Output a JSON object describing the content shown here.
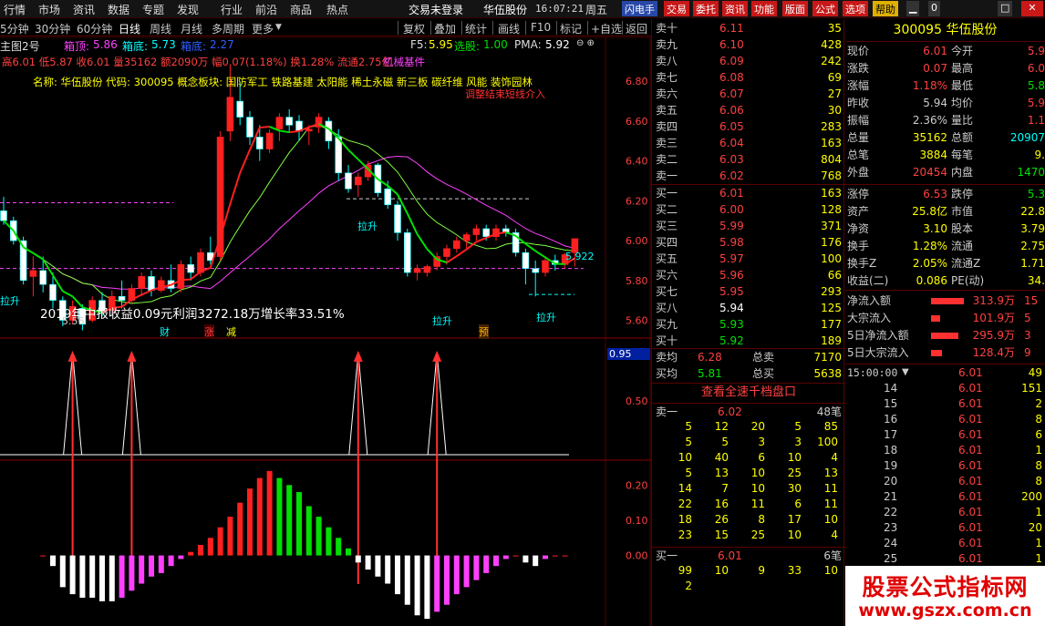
{
  "menu": {
    "items": [
      "行情",
      "市场",
      "资讯",
      "数据",
      "专题",
      "发现",
      "行业",
      "前沿",
      "商品",
      "热点"
    ],
    "trade_status": "交易未登录",
    "stock_name": "华伍股份",
    "time": "16:07:21",
    "weekday": "周五",
    "buttons": [
      "闪电手",
      "交易",
      "委托",
      "资讯",
      "功能",
      "版面",
      "公式",
      "选项",
      "帮助"
    ],
    "badge": "0"
  },
  "toolbar": {
    "periods": [
      "5分钟",
      "30分钟",
      "60分钟",
      "日线",
      "周线",
      "月线",
      "多周期",
      "更多"
    ],
    "actions": [
      "复权",
      "叠加",
      "统计",
      "画线",
      "F10",
      "标记",
      "+自选",
      "返回"
    ]
  },
  "chart_info": {
    "indicator_name": "主图2号",
    "box_top_label": "箱顶:",
    "box_top_value": "5.86",
    "box_bottom_label": "箱底:",
    "box_bottom_value": "5.73",
    "box_third_label": "箱底:",
    "box_third_value": "2.27",
    "f5_label": "F5:",
    "f5_value": "5.95",
    "pick_label": "选股:",
    "pick_value": "1.00",
    "pma_label": "PMA:",
    "pma_value": "5.92",
    "ohlc_line": "高6.01 低5.87 收6.01 量35162 额2090万 幅0.07(1.18%) 换1.28% 流通2.75亿",
    "industry": "机械基件",
    "concept_line": "名称: 华伍股份 代码: 300095 概念板块: 国防军工 铁路基建 太阳能 稀土永磁 新三板 碳纤维 风能 装饰园林",
    "annotation_right": "调整结束短线介入",
    "earnings": "2019年中报收益0.09元利润3272.18万增长率33.51%",
    "low_label": "5.56",
    "last_label": "5.922",
    "ascend_labels": [
      "拉升",
      "拉升",
      "拉升",
      "拉升"
    ],
    "event_labels": [
      "财",
      "涨",
      "减",
      "预"
    ],
    "osc_value": "0.95"
  },
  "chart_data": [
    {
      "type": "candlestick",
      "title": "",
      "yticks": [
        "6.80",
        "6.60",
        "6.40",
        "6.20",
        "6.00",
        "5.80",
        "5.60"
      ],
      "ylim": [
        5.52,
        6.92
      ],
      "candles": [
        {
          "o": 6.15,
          "h": 6.22,
          "l": 6.08,
          "c": 6.1
        },
        {
          "o": 6.1,
          "h": 6.12,
          "l": 5.98,
          "c": 6.0
        },
        {
          "o": 6.0,
          "h": 6.02,
          "l": 5.78,
          "c": 5.8
        },
        {
          "o": 5.82,
          "h": 5.92,
          "l": 5.72,
          "c": 5.85
        },
        {
          "o": 5.85,
          "h": 5.92,
          "l": 5.74,
          "c": 5.78
        },
        {
          "o": 5.78,
          "h": 5.84,
          "l": 5.66,
          "c": 5.7
        },
        {
          "o": 5.7,
          "h": 5.72,
          "l": 5.57,
          "c": 5.6
        },
        {
          "o": 5.6,
          "h": 5.7,
          "l": 5.58,
          "c": 5.67
        },
        {
          "o": 5.66,
          "h": 5.68,
          "l": 5.55,
          "c": 5.58
        },
        {
          "o": 5.6,
          "h": 5.72,
          "l": 5.59,
          "c": 5.7
        },
        {
          "o": 5.7,
          "h": 5.74,
          "l": 5.62,
          "c": 5.64
        },
        {
          "o": 5.65,
          "h": 5.75,
          "l": 5.63,
          "c": 5.72
        },
        {
          "o": 5.72,
          "h": 5.8,
          "l": 5.66,
          "c": 5.7
        },
        {
          "o": 5.7,
          "h": 5.78,
          "l": 5.68,
          "c": 5.76
        },
        {
          "o": 5.76,
          "h": 5.84,
          "l": 5.72,
          "c": 5.82
        },
        {
          "o": 5.82,
          "h": 5.85,
          "l": 5.72,
          "c": 5.75
        },
        {
          "o": 5.75,
          "h": 5.82,
          "l": 5.74,
          "c": 5.8
        },
        {
          "o": 5.8,
          "h": 5.88,
          "l": 5.74,
          "c": 5.76
        },
        {
          "o": 5.76,
          "h": 5.9,
          "l": 5.74,
          "c": 5.88
        },
        {
          "o": 5.88,
          "h": 5.92,
          "l": 5.8,
          "c": 5.84
        },
        {
          "o": 5.84,
          "h": 5.96,
          "l": 5.82,
          "c": 5.94
        },
        {
          "o": 5.94,
          "h": 6.02,
          "l": 5.88,
          "c": 5.9
        },
        {
          "o": 5.92,
          "h": 6.55,
          "l": 5.9,
          "c": 6.52
        },
        {
          "o": 6.55,
          "h": 6.88,
          "l": 6.5,
          "c": 6.72
        },
        {
          "o": 6.7,
          "h": 6.8,
          "l": 6.58,
          "c": 6.62
        },
        {
          "o": 6.62,
          "h": 6.65,
          "l": 6.48,
          "c": 6.52
        },
        {
          "o": 6.52,
          "h": 6.58,
          "l": 6.4,
          "c": 6.46
        },
        {
          "o": 6.46,
          "h": 6.56,
          "l": 6.44,
          "c": 6.54
        },
        {
          "o": 6.56,
          "h": 6.64,
          "l": 6.5,
          "c": 6.62
        },
        {
          "o": 6.62,
          "h": 6.66,
          "l": 6.54,
          "c": 6.58
        },
        {
          "o": 6.6,
          "h": 6.63,
          "l": 6.5,
          "c": 6.55
        },
        {
          "o": 6.55,
          "h": 6.58,
          "l": 6.48,
          "c": 6.56
        },
        {
          "o": 6.57,
          "h": 6.64,
          "l": 6.54,
          "c": 6.62
        },
        {
          "o": 6.6,
          "h": 6.62,
          "l": 6.46,
          "c": 6.5
        },
        {
          "o": 6.52,
          "h": 6.56,
          "l": 6.3,
          "c": 6.34
        },
        {
          "o": 6.34,
          "h": 6.38,
          "l": 6.24,
          "c": 6.26
        },
        {
          "o": 6.28,
          "h": 6.34,
          "l": 6.22,
          "c": 6.32
        },
        {
          "o": 6.32,
          "h": 6.4,
          "l": 6.3,
          "c": 6.38
        },
        {
          "o": 6.38,
          "h": 6.39,
          "l": 6.22,
          "c": 6.24
        },
        {
          "o": 6.26,
          "h": 6.3,
          "l": 6.16,
          "c": 6.18
        },
        {
          "o": 6.18,
          "h": 6.2,
          "l": 6.0,
          "c": 6.04
        },
        {
          "o": 6.04,
          "h": 6.06,
          "l": 5.82,
          "c": 5.84
        },
        {
          "o": 5.84,
          "h": 5.88,
          "l": 5.8,
          "c": 5.86
        },
        {
          "o": 5.84,
          "h": 5.88,
          "l": 5.82,
          "c": 5.87
        },
        {
          "o": 5.87,
          "h": 5.94,
          "l": 5.85,
          "c": 5.92
        },
        {
          "o": 5.92,
          "h": 5.98,
          "l": 5.88,
          "c": 5.96
        },
        {
          "o": 5.96,
          "h": 6.02,
          "l": 5.94,
          "c": 6.0
        },
        {
          "o": 6.0,
          "h": 6.04,
          "l": 5.96,
          "c": 6.03
        },
        {
          "o": 6.03,
          "h": 6.08,
          "l": 6.0,
          "c": 6.06
        },
        {
          "o": 6.06,
          "h": 6.08,
          "l": 6.0,
          "c": 6.02
        },
        {
          "o": 6.02,
          "h": 6.08,
          "l": 6.0,
          "c": 6.06
        },
        {
          "o": 6.06,
          "h": 6.08,
          "l": 6.02,
          "c": 6.04
        },
        {
          "o": 6.04,
          "h": 6.06,
          "l": 5.92,
          "c": 5.94
        },
        {
          "o": 5.94,
          "h": 5.96,
          "l": 5.78,
          "c": 5.86
        },
        {
          "o": 5.86,
          "h": 5.9,
          "l": 5.72,
          "c": 5.84
        },
        {
          "o": 5.84,
          "h": 5.92,
          "l": 5.82,
          "c": 5.9
        },
        {
          "o": 5.9,
          "h": 5.93,
          "l": 5.85,
          "c": 5.88
        },
        {
          "o": 5.88,
          "h": 5.94,
          "l": 5.86,
          "c": 5.93
        },
        {
          "o": 5.94,
          "h": 6.01,
          "l": 5.87,
          "c": 6.01
        }
      ]
    },
    {
      "type": "line",
      "title": "",
      "yticks": [
        "0.95",
        "0.50"
      ],
      "ylim": [
        0,
        1
      ],
      "spike_index": [
        7,
        13,
        36,
        44
      ]
    },
    {
      "type": "bar",
      "title": "",
      "yticks": [
        "0.20",
        "0.10",
        "0.00"
      ],
      "ylim": [
        -0.19,
        0.25
      ],
      "values": [
        0.0,
        -0.03,
        -0.09,
        -0.11,
        -0.12,
        -0.12,
        -0.13,
        -0.13,
        -0.12,
        -0.1,
        -0.08,
        -0.06,
        -0.05,
        -0.03,
        -0.01,
        0.01,
        0.03,
        0.05,
        0.08,
        0.11,
        0.15,
        0.19,
        0.22,
        0.24,
        0.22,
        0.2,
        0.18,
        0.14,
        0.11,
        0.08,
        0.05,
        0.02,
        -0.02,
        -0.04,
        -0.06,
        -0.08,
        -0.11,
        -0.14,
        -0.17,
        -0.18,
        -0.16,
        -0.14,
        -0.11,
        -0.09,
        -0.07,
        -0.05,
        -0.03,
        -0.01,
        0.0,
        -0.02,
        -0.03,
        -0.01,
        0.0,
        0.0
      ]
    }
  ],
  "orderbook": {
    "asks": [
      {
        "label": "卖十",
        "price": "6.11",
        "vol": "35"
      },
      {
        "label": "卖九",
        "price": "6.10",
        "vol": "428"
      },
      {
        "label": "卖八",
        "price": "6.09",
        "vol": "242"
      },
      {
        "label": "卖七",
        "price": "6.08",
        "vol": "69"
      },
      {
        "label": "卖六",
        "price": "6.07",
        "vol": "27"
      },
      {
        "label": "卖五",
        "price": "6.06",
        "vol": "30"
      },
      {
        "label": "卖四",
        "price": "6.05",
        "vol": "283"
      },
      {
        "label": "卖三",
        "price": "6.04",
        "vol": "163"
      },
      {
        "label": "卖二",
        "price": "6.03",
        "vol": "804"
      },
      {
        "label": "卖一",
        "price": "6.02",
        "vol": "768"
      }
    ],
    "bids": [
      {
        "label": "买一",
        "price": "6.01",
        "vol": "163"
      },
      {
        "label": "买二",
        "price": "6.00",
        "vol": "128"
      },
      {
        "label": "买三",
        "price": "5.99",
        "vol": "371"
      },
      {
        "label": "买四",
        "price": "5.98",
        "vol": "176"
      },
      {
        "label": "买五",
        "price": "5.97",
        "vol": "100"
      },
      {
        "label": "买六",
        "price": "5.96",
        "vol": "66"
      },
      {
        "label": "买七",
        "price": "5.95",
        "vol": "293"
      },
      {
        "label": "买八",
        "price": "5.94",
        "vol": "125"
      },
      {
        "label": "买九",
        "price": "5.93",
        "vol": "177"
      },
      {
        "label": "买十",
        "price": "5.92",
        "vol": "189"
      }
    ],
    "avg_ask_label": "卖均",
    "avg_ask": "6.28",
    "total_ask_label": "总卖",
    "total_ask": "7170",
    "avg_bid_label": "买均",
    "avg_bid": "5.81",
    "total_bid_label": "总买",
    "total_bid": "5638",
    "full_depth_link": "查看全速千档盘口",
    "ask1_label": "卖一",
    "ask1_price": "6.02",
    "ask1_count": "48笔",
    "ask1_queue": [
      [
        "5",
        "12",
        "20",
        "5",
        "85"
      ],
      [
        "5",
        "5",
        "3",
        "3",
        "100"
      ],
      [
        "10",
        "40",
        "6",
        "10",
        "4"
      ],
      [
        "5",
        "13",
        "10",
        "25",
        "13"
      ],
      [
        "14",
        "7",
        "10",
        "30",
        "11"
      ],
      [
        "22",
        "16",
        "11",
        "6",
        "11"
      ],
      [
        "18",
        "26",
        "8",
        "17",
        "10"
      ],
      [
        "23",
        "15",
        "25",
        "10",
        "4"
      ]
    ],
    "bid1_label": "买一",
    "bid1_price": "6.01",
    "bid1_count": "6笔",
    "bid1_queue": [
      [
        "99",
        "10",
        "9",
        "33",
        "10"
      ],
      [
        "2",
        "",
        "",
        "",
        ""
      ]
    ]
  },
  "quote": {
    "code": "300095",
    "name": "华伍股份",
    "rows": [
      [
        "现价",
        "6.01",
        "今开",
        "5.9"
      ],
      [
        "涨跌",
        "0.07",
        "最高",
        "6.0"
      ],
      [
        "涨幅",
        "1.18%",
        "最低",
        "5.8"
      ],
      [
        "昨收",
        "5.94",
        "均价",
        "5.9"
      ],
      [
        "振幅",
        "2.36%",
        "量比",
        "1.1"
      ],
      [
        "总量",
        "35162",
        "总额",
        "20907"
      ],
      [
        "总笔",
        "3884",
        "每笔",
        "9."
      ],
      [
        "外盘",
        "20454",
        "内盘",
        "1470"
      ]
    ],
    "rows2": [
      [
        "涨停",
        "6.53",
        "跌停",
        "5.3"
      ],
      [
        "资产",
        "25.8亿",
        "市值",
        "22.8"
      ],
      [
        "净资",
        "3.10",
        "股本",
        "3.79"
      ],
      [
        "换手",
        "1.28%",
        "流通",
        "2.75"
      ],
      [
        "换手Z",
        "2.05%",
        "流通Z",
        "1.71"
      ],
      [
        "收益(二)",
        "0.086",
        "PE(动)",
        "34."
      ]
    ],
    "flows": [
      {
        "label": "净流入额",
        "value": "313.9万",
        "extra": "15"
      },
      {
        "label": "大宗流入",
        "value": "101.9万",
        "extra": "5"
      },
      {
        "label": "5日净流入额",
        "value": "295.9万",
        "extra": "3"
      },
      {
        "label": "5日大宗流入",
        "value": "128.4万",
        "extra": "9"
      }
    ]
  },
  "ticks": {
    "header_time": "15:00:00",
    "header_price": "6.01",
    "header_vol": "49",
    "rows": [
      [
        "14",
        "6.01",
        "151"
      ],
      [
        "15",
        "6.01",
        "2"
      ],
      [
        "16",
        "6.01",
        "8"
      ],
      [
        "17",
        "6.01",
        "6"
      ],
      [
        "18",
        "6.01",
        "1"
      ],
      [
        "19",
        "6.01",
        "8"
      ],
      [
        "20",
        "6.01",
        "8"
      ],
      [
        "21",
        "6.01",
        "200"
      ],
      [
        "22",
        "6.01",
        "1"
      ],
      [
        "23",
        "6.01",
        "20"
      ],
      [
        "24",
        "6.01",
        "1"
      ],
      [
        "25",
        "6.01",
        "1"
      ],
      [
        "26",
        "6.01",
        ""
      ]
    ]
  },
  "watermark": {
    "line1": "股票公式指标网",
    "line2": "www.gszx.com.cn"
  },
  "colors": {
    "up": "#ff2020",
    "down": "#00ffff",
    "yellow": "#ffff00",
    "green": "#00e000",
    "magenta": "#ff40ff",
    "grid_red": "#5a0000"
  }
}
